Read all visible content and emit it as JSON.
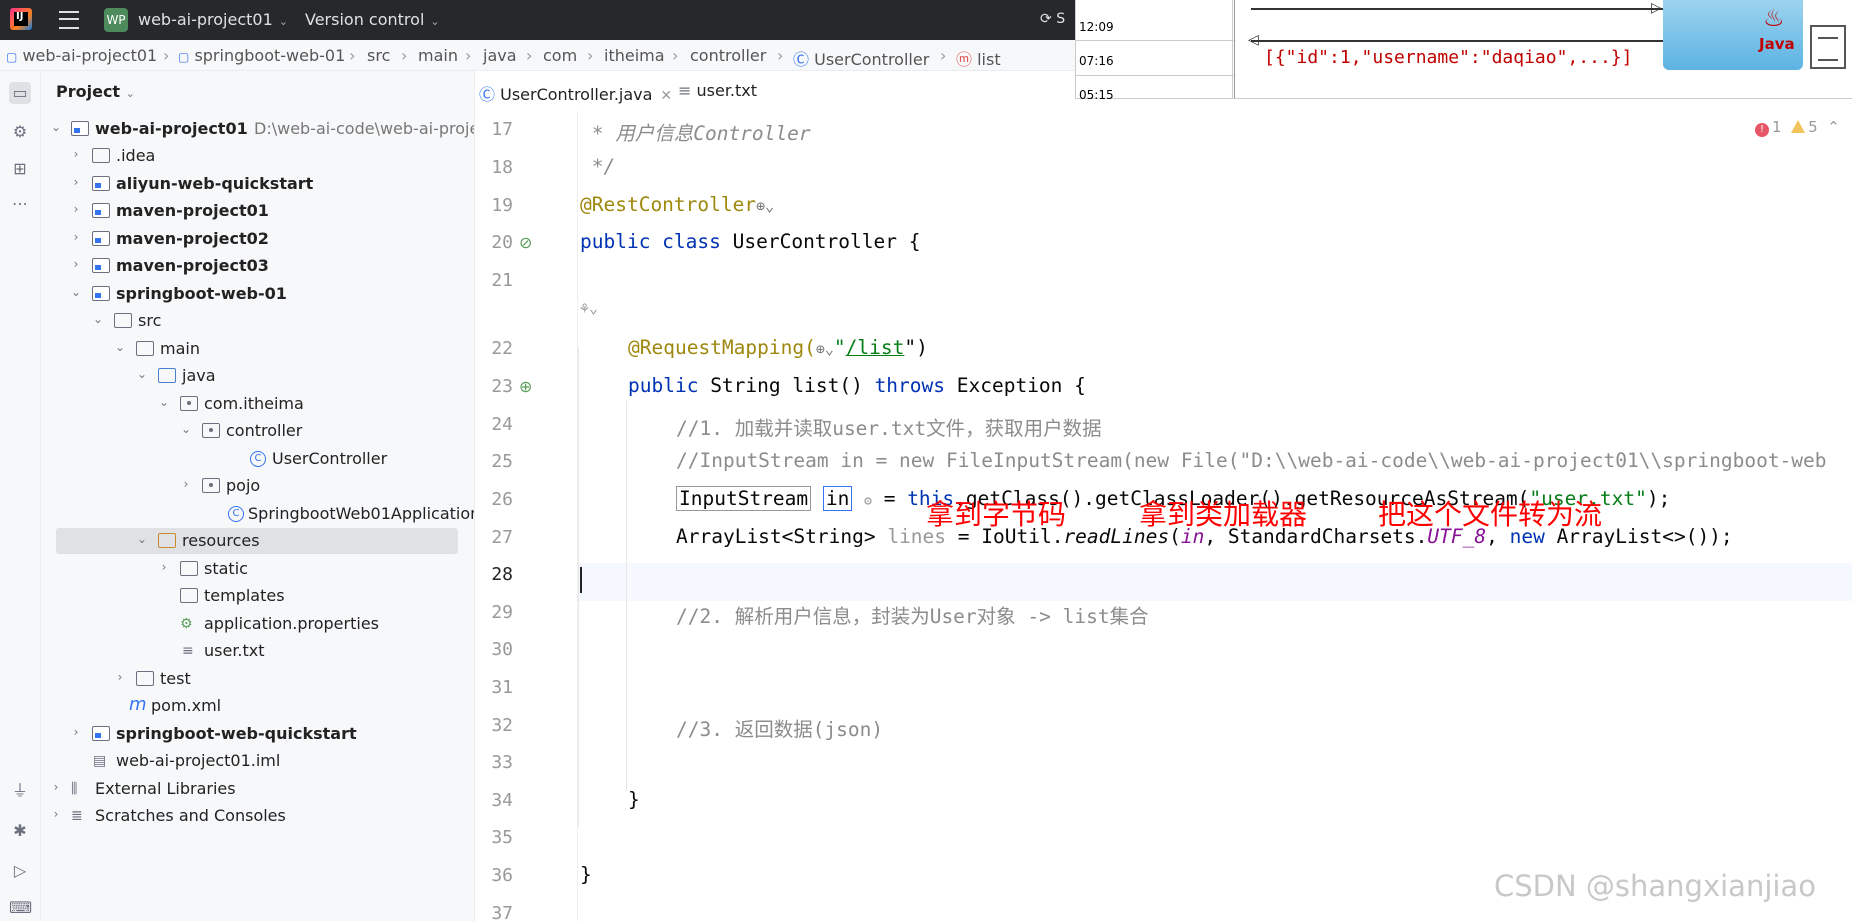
{
  "titlebar": {
    "badge": "WP",
    "project": "web-ai-project01",
    "version_control": "Version control",
    "right_label": "S"
  },
  "breadcrumb": [
    "web-ai-project01",
    "springboot-web-01",
    "src",
    "main",
    "java",
    "com",
    "itheima",
    "controller",
    "UserController",
    "list"
  ],
  "project_panel": {
    "title": "Project",
    "tree": [
      {
        "label": "web-ai-project01",
        "path": "D:\\web-ai-code\\web-ai-proje"
      },
      {
        "label": ".idea"
      },
      {
        "label": "aliyun-web-quickstart"
      },
      {
        "label": "maven-project01"
      },
      {
        "label": "maven-project02"
      },
      {
        "label": "maven-project03"
      },
      {
        "label": "springboot-web-01"
      },
      {
        "label": "src"
      },
      {
        "label": "main"
      },
      {
        "label": "java"
      },
      {
        "label": "com.itheima"
      },
      {
        "label": "controller"
      },
      {
        "label": "UserController"
      },
      {
        "label": "pojo"
      },
      {
        "label": "SpringbootWeb01Application"
      },
      {
        "label": "resources"
      },
      {
        "label": "static"
      },
      {
        "label": "templates"
      },
      {
        "label": "application.properties"
      },
      {
        "label": "user.txt"
      },
      {
        "label": "test"
      },
      {
        "label": "pom.xml"
      },
      {
        "label": "springboot-web-quickstart"
      },
      {
        "label": "web-ai-project01.iml"
      },
      {
        "label": "External Libraries"
      },
      {
        "label": "Scratches and Consoles"
      }
    ]
  },
  "tabs": [
    {
      "label": "UserController.java",
      "active": true
    },
    {
      "label": "user.txt",
      "active": false
    }
  ],
  "editor": {
    "line_numbers": [
      "17",
      "18",
      "19",
      "20",
      "21",
      "",
      "22",
      "23",
      "24",
      "25",
      "26",
      "27",
      "28",
      "29",
      "30",
      "31",
      "32",
      "33",
      "34",
      "35",
      "36",
      "37"
    ],
    "lines": {
      "l17": " * 用户信息Controller",
      "l18": " */",
      "l19a": "@RestController",
      "l20a": "public class ",
      "l20b": "UserController {",
      "l22a": "@RequestMapping(",
      "l22b": "\"",
      "l22c": "/list",
      "l22d": "\")",
      "l23a": "public ",
      "l23b": "String list() ",
      "l23c": "throws ",
      "l23d": "Exception {",
      "l24": "//1. 加载并读取user.txt文件，获取用户数据",
      "l25": "//InputStream in = new FileInputStream(new File(\"D:\\\\web-ai-code\\\\web-ai-project01\\\\springboot-web",
      "l26a": "InputStream",
      "l26b": "in",
      "l26c": " = ",
      "l26d": "this",
      "l26e": ".getClass().getClassLoader().getResourceAsStream(",
      "l26f": "\"user.txt\"",
      "l26g": ");",
      "l27a": "ArrayList<String> ",
      "l27b": "lines",
      "l27c": " = IoUtil.",
      "l27d": "readLines",
      "l27e": "(",
      "l27f": "in",
      "l27g": ", StandardCharsets.",
      "l27h": "UTF_8",
      "l27i": ", ",
      "l27j": "new ",
      "l27k": "ArrayList<>());",
      "l29": "//2. 解析用户信息，封装为User对象 -> list集合",
      "l32": "//3. 返回数据(json)",
      "l34": "}",
      "l36": "}"
    },
    "annotations": [
      "拿到字节码",
      "拿到类加载器",
      "把这个文件转为流"
    ]
  },
  "inspections": {
    "errors": "1",
    "warnings": "5"
  },
  "overlay": {
    "times": [
      "12:09",
      "07:16",
      "05:15"
    ],
    "json": "[{\"id\":1,\"username\":\"daqiao\",...}]",
    "java_label": "Java"
  },
  "watermark": "CSDN @shangxianjiao"
}
